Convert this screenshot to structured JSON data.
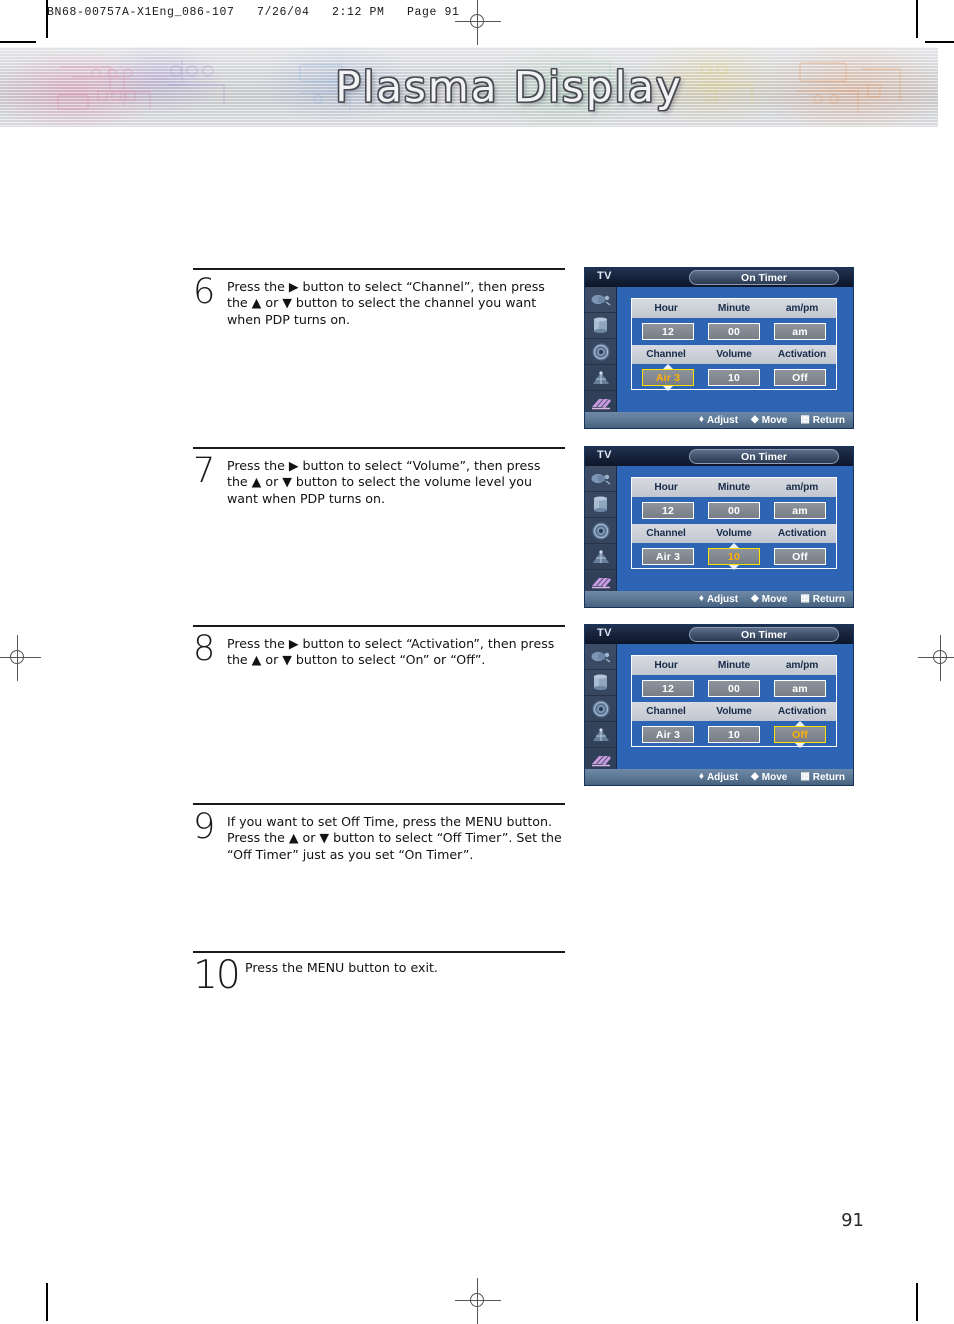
{
  "header": {
    "file_code": "BN68-00757A-X1Eng_086-107   7/26/04   2:12 PM   Page 91"
  },
  "banner": {
    "title": "Plasma Display"
  },
  "page": {
    "number": "91"
  },
  "steps": [
    {
      "number": "6",
      "text": "Press the ▶ button to select “Channel”, then press the ▲ or ▼ button to select the channel you want when PDP turns on."
    },
    {
      "number": "7",
      "text": "Press the ▶ button to select “Volume”, then press the ▲ or ▼ button to select the volume level you want when PDP turns on."
    },
    {
      "number": "8",
      "text": "Press the ▶ button to select “Activation”, then press the ▲ or ▼ button to select “On” or “Off”."
    },
    {
      "number": "9",
      "text": "If you want to set Off Time, press the MENU button. Press the ▲ or ▼ button to select “Off Timer”. Set the “Off Timer” just as you set “On Timer”."
    },
    {
      "number": "10",
      "text": "Press the MENU button to exit."
    }
  ],
  "osd_common": {
    "source_label": "TV",
    "menu_title": "On Timer",
    "headers_row1": [
      "Hour",
      "Minute",
      "am/pm"
    ],
    "headers_row2": [
      "Channel",
      "Volume",
      "Activation"
    ],
    "values_row1": [
      "12",
      "00",
      "am"
    ],
    "values_row2": [
      "Air  3",
      "10",
      "Off"
    ],
    "footer": {
      "adjust": "Adjust",
      "move": "Move",
      "return": "Return",
      "adjust_icon": "up-down-arrows-icon",
      "move_icon": "left-right-arrows-icon",
      "return_icon": "menu-button-icon"
    },
    "sidebar_icons": [
      "input-source-icon",
      "picture-icon",
      "sound-icon",
      "channel-antenna-icon",
      "setup-icon"
    ],
    "colors": {
      "panel_blue": "#2e64b4",
      "titlebar_navy": "#16223a",
      "selected_border": "#ffe000",
      "selected_text": "#ffb000",
      "cell_gray": "#7f858e"
    }
  },
  "osd_screens": [
    {
      "selected_row": 2,
      "selected_index": 0,
      "selected_value": "Air  3"
    },
    {
      "selected_row": 2,
      "selected_index": 1,
      "selected_value": "10"
    },
    {
      "selected_row": 2,
      "selected_index": 2,
      "selected_value": "Off"
    }
  ]
}
